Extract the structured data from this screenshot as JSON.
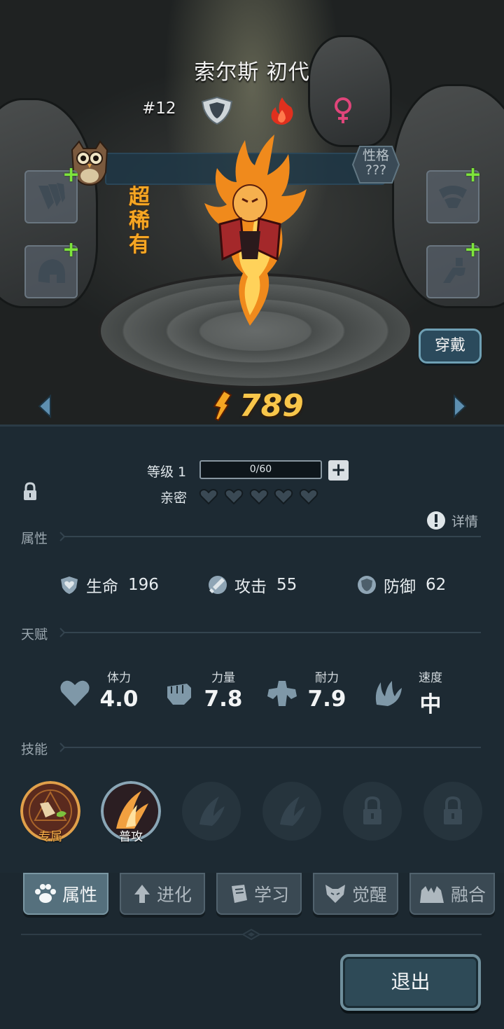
{
  "header": {
    "title": "索尔斯 初代",
    "rank": "#12",
    "trait": "性格\n???",
    "rarity": "超稀有",
    "power": "789",
    "wear_button": "穿戴"
  },
  "level": {
    "label": "等级 1",
    "xp": "0/60",
    "xp_progress": 0,
    "intimacy_label": "亲密",
    "intimacy_hearts": 5,
    "details": "详情"
  },
  "attributes": {
    "section": "属性",
    "hp_label": "生命",
    "hp": "196",
    "atk_label": "攻击",
    "atk": "55",
    "def_label": "防御",
    "def": "62"
  },
  "talents": {
    "section": "天赋",
    "items": [
      {
        "label": "体力",
        "value": "4.0",
        "icon": "heart-icon"
      },
      {
        "label": "力量",
        "value": "7.8",
        "icon": "fist-icon"
      },
      {
        "label": "耐力",
        "value": "7.9",
        "icon": "muscle-icon"
      },
      {
        "label": "速度",
        "value": "中",
        "icon": "wing-icon"
      }
    ]
  },
  "skills": {
    "section": "技能",
    "items": [
      {
        "label": "专属",
        "state": "equipped"
      },
      {
        "label": "普攻",
        "state": "equipped"
      },
      {
        "label": "",
        "state": "empty"
      },
      {
        "label": "",
        "state": "empty"
      },
      {
        "label": "",
        "state": "locked"
      },
      {
        "label": "",
        "state": "locked"
      }
    ]
  },
  "tabs": [
    {
      "label": "属性",
      "active": true
    },
    {
      "label": "进化",
      "active": false
    },
    {
      "label": "学习",
      "active": false
    },
    {
      "label": "觉醒",
      "active": false
    },
    {
      "label": "融合",
      "active": false
    }
  ],
  "exit_button": "退出",
  "colors": {
    "accent": "#f8c64a",
    "rarity": "#f6a623",
    "plus": "#7ee53c",
    "gender": "#e0457a",
    "fire": "#e0301e"
  }
}
